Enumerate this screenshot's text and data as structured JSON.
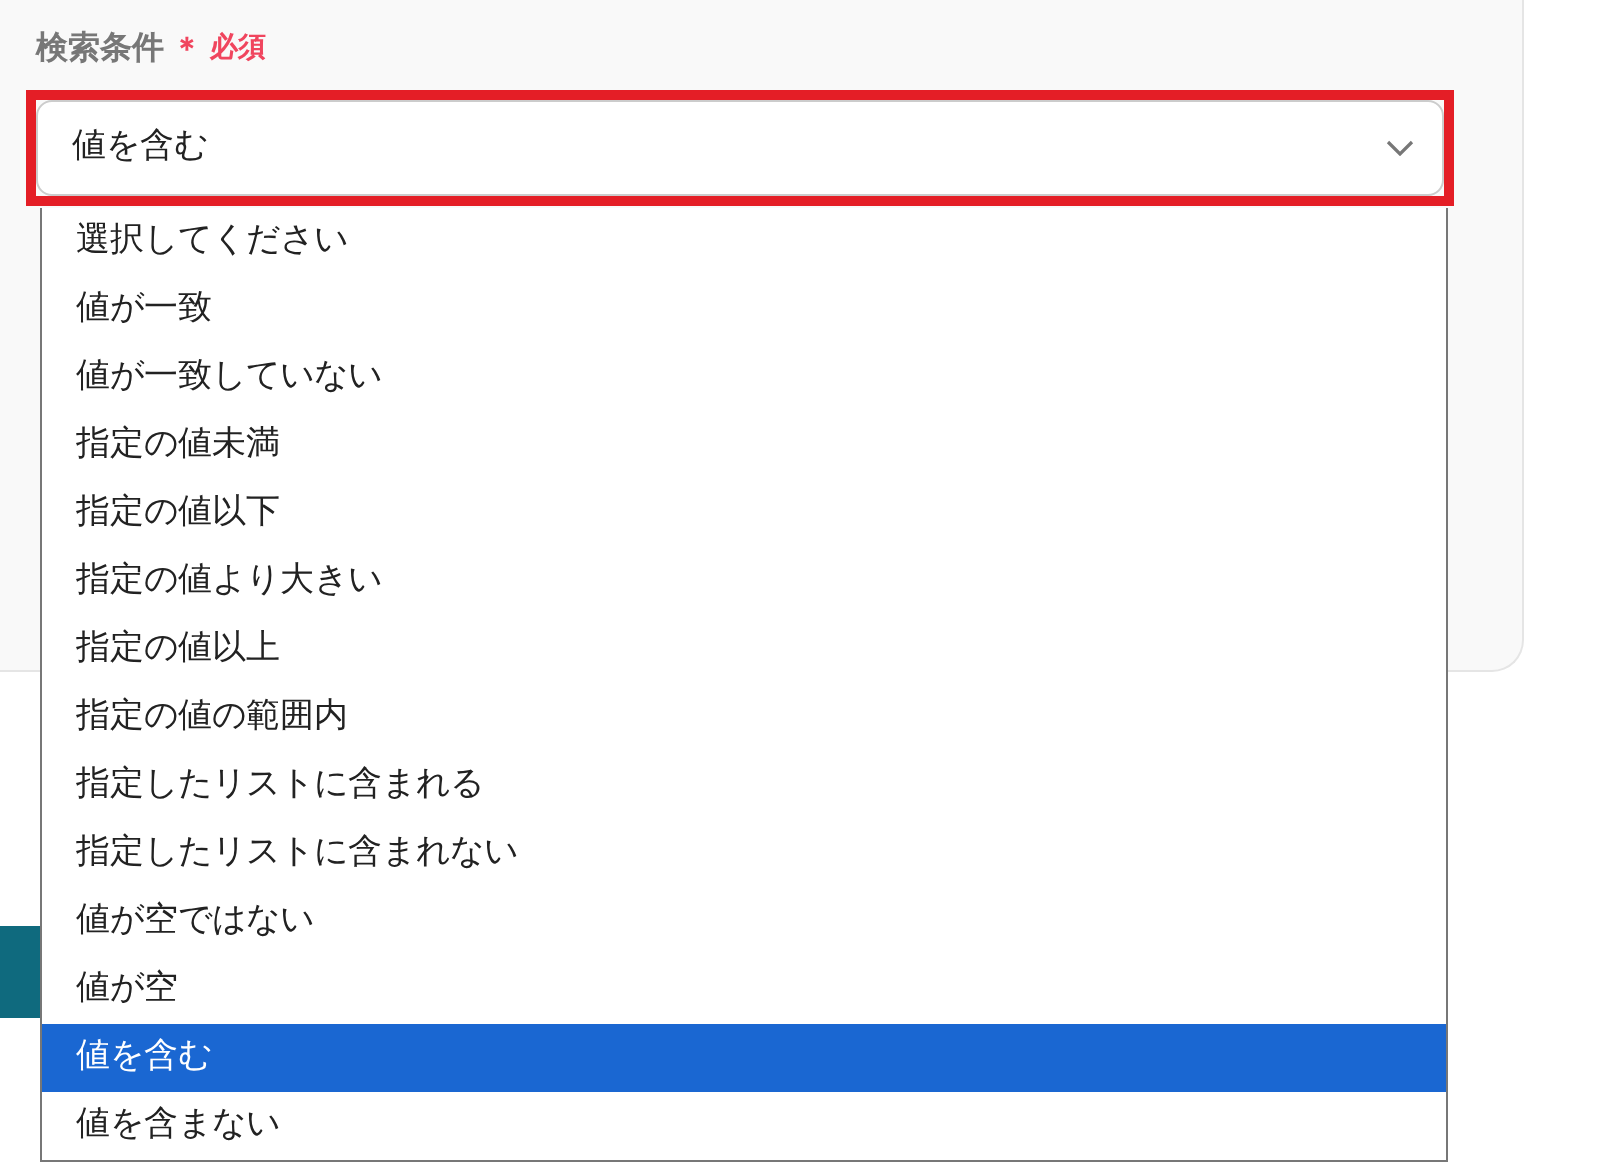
{
  "field": {
    "label": "検索条件",
    "required_mark": "＊",
    "required_text": "必須",
    "value": "値を含む",
    "open": true
  },
  "options": [
    {
      "label": "選択してください",
      "selected": false
    },
    {
      "label": "値が一致",
      "selected": false
    },
    {
      "label": "値が一致していない",
      "selected": false
    },
    {
      "label": "指定の値未満",
      "selected": false
    },
    {
      "label": "指定の値以下",
      "selected": false
    },
    {
      "label": "指定の値より大きい",
      "selected": false
    },
    {
      "label": "指定の値以上",
      "selected": false
    },
    {
      "label": "指定の値の範囲内",
      "selected": false
    },
    {
      "label": "指定したリストに含まれる",
      "selected": false
    },
    {
      "label": "指定したリストに含まれない",
      "selected": false
    },
    {
      "label": "値が空ではない",
      "selected": false
    },
    {
      "label": "値が空",
      "selected": false
    },
    {
      "label": "値を含む",
      "selected": true
    },
    {
      "label": "値を含まない",
      "selected": false
    }
  ]
}
